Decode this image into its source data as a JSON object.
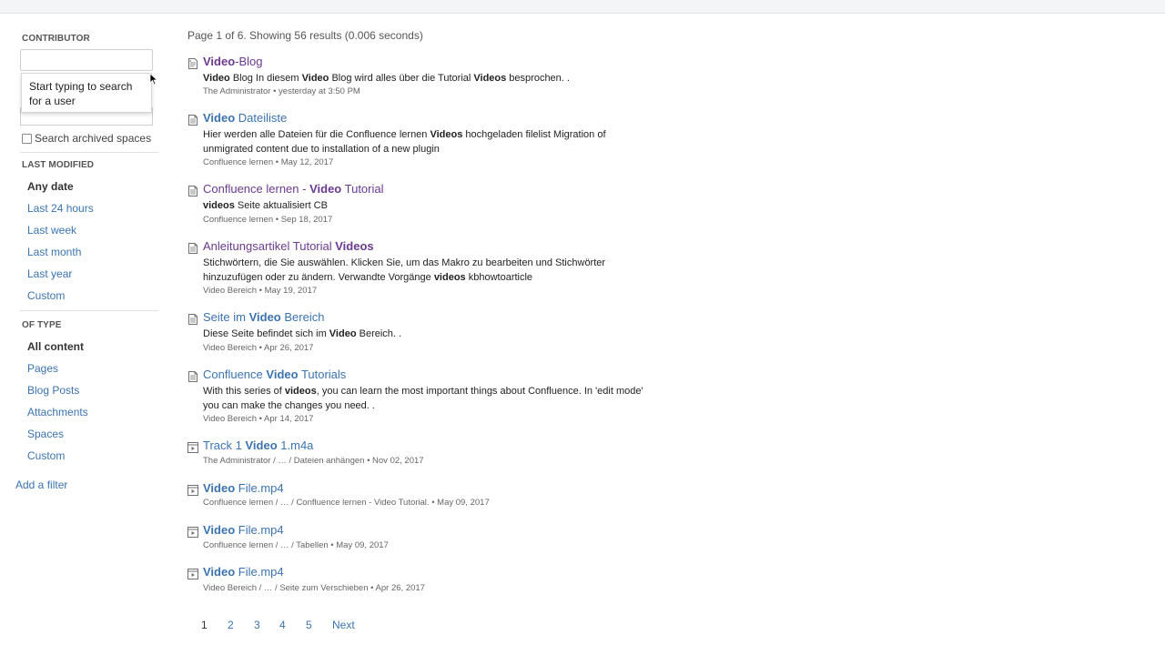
{
  "sidebar": {
    "contributor_title": "CONTRIBUTOR",
    "contributor_tooltip": "Start typing to search for a user",
    "archived_label": "Search archived spaces",
    "last_modified_title": "LAST MODIFIED",
    "last_modified": [
      {
        "label": "Any date",
        "active": true
      },
      {
        "label": "Last 24 hours",
        "active": false
      },
      {
        "label": "Last week",
        "active": false
      },
      {
        "label": "Last month",
        "active": false
      },
      {
        "label": "Last year",
        "active": false
      },
      {
        "label": "Custom",
        "active": false
      }
    ],
    "of_type_title": "OF TYPE",
    "of_type": [
      {
        "label": "All content",
        "active": true
      },
      {
        "label": "Pages",
        "active": false
      },
      {
        "label": "Blog Posts",
        "active": false
      },
      {
        "label": "Attachments",
        "active": false
      },
      {
        "label": "Spaces",
        "active": false
      },
      {
        "label": "Custom",
        "active": false
      }
    ],
    "add_filter": "Add a filter"
  },
  "results_summary": "Page 1 of 6. Showing 56 results (0.006 seconds)",
  "results": [
    {
      "icon": "blog-icon",
      "title_html": "<b>Video</b>-Blog",
      "visited": true,
      "excerpt_html": "<b>Video</b> Blog In diesem <b>Video</b> Blog wird alles über die Tutorial <b>Videos</b> besprochen. .",
      "meta": "The Administrator • yesterday at 3:50 PM"
    },
    {
      "icon": "page-icon",
      "title_html": "<b>Video</b> Dateiliste",
      "visited": false,
      "excerpt_html": "Hier werden alle Dateien für die Confluence lernen <b>Videos</b> hochgeladen filelist Migration of unmigrated content due to installation of a new plugin",
      "meta": "Confluence lernen • May 12, 2017"
    },
    {
      "icon": "page-icon",
      "title_html": "Confluence lernen - <b>Video</b> Tutorial",
      "visited": true,
      "excerpt_html": "<b>videos</b> Seite aktualisiert CB",
      "meta": "Confluence lernen • Sep 18, 2017"
    },
    {
      "icon": "page-icon",
      "title_html": "Anleitungsartikel Tutorial <b>Videos</b>",
      "visited": true,
      "excerpt_html": "Stichwörtern, die Sie auswählen. Klicken Sie, um das Makro zu bearbeiten und Stichwörter hinzuzufügen oder zu ändern. Verwandte Vorgänge <b>videos</b> kbhowtoarticle",
      "meta": "Video Bereich • May 19, 2017"
    },
    {
      "icon": "page-icon",
      "title_html": "Seite im <b>Video</b> Bereich",
      "visited": false,
      "excerpt_html": "Diese Seite befindet sich im <b>Video</b> Bereich. .",
      "meta": "Video Bereich • Apr 26, 2017"
    },
    {
      "icon": "page-icon",
      "title_html": "Confluence <b>Video</b> Tutorials",
      "visited": false,
      "excerpt_html": "With this series of <b>videos</b>, you can learn the most important things about Confluence. In 'edit mode' you can make the changes you need. .",
      "meta": "Video Bereich • Apr 14, 2017"
    },
    {
      "icon": "video-file-icon",
      "title_html": "Track 1 <b>Video</b> 1.m4a",
      "visited": false,
      "excerpt_html": "",
      "meta": "The Administrator / … / Dateien anhängen • Nov 02, 2017"
    },
    {
      "icon": "video-file-icon",
      "title_html": "<b>Video</b> File.mp4",
      "visited": false,
      "excerpt_html": "",
      "meta": "Confluence lernen / … / Confluence lernen - Video Tutorial. • May 09, 2017"
    },
    {
      "icon": "video-file-icon",
      "title_html": "<b>Video</b> File.mp4",
      "visited": false,
      "excerpt_html": "",
      "meta": "Confluence lernen / … / Tabellen • May 09, 2017"
    },
    {
      "icon": "video-file-icon",
      "title_html": "<b>Video</b> File.mp4",
      "visited": false,
      "excerpt_html": "",
      "meta": "Video Bereich / … / Seite zum Verschieben • Apr 26, 2017"
    }
  ],
  "pagination": {
    "pages": [
      "1",
      "2",
      "3",
      "4",
      "5"
    ],
    "current": "1",
    "next_label": "Next"
  },
  "colors": {
    "link": "#3b73af",
    "visited": "#6b3a8e"
  }
}
